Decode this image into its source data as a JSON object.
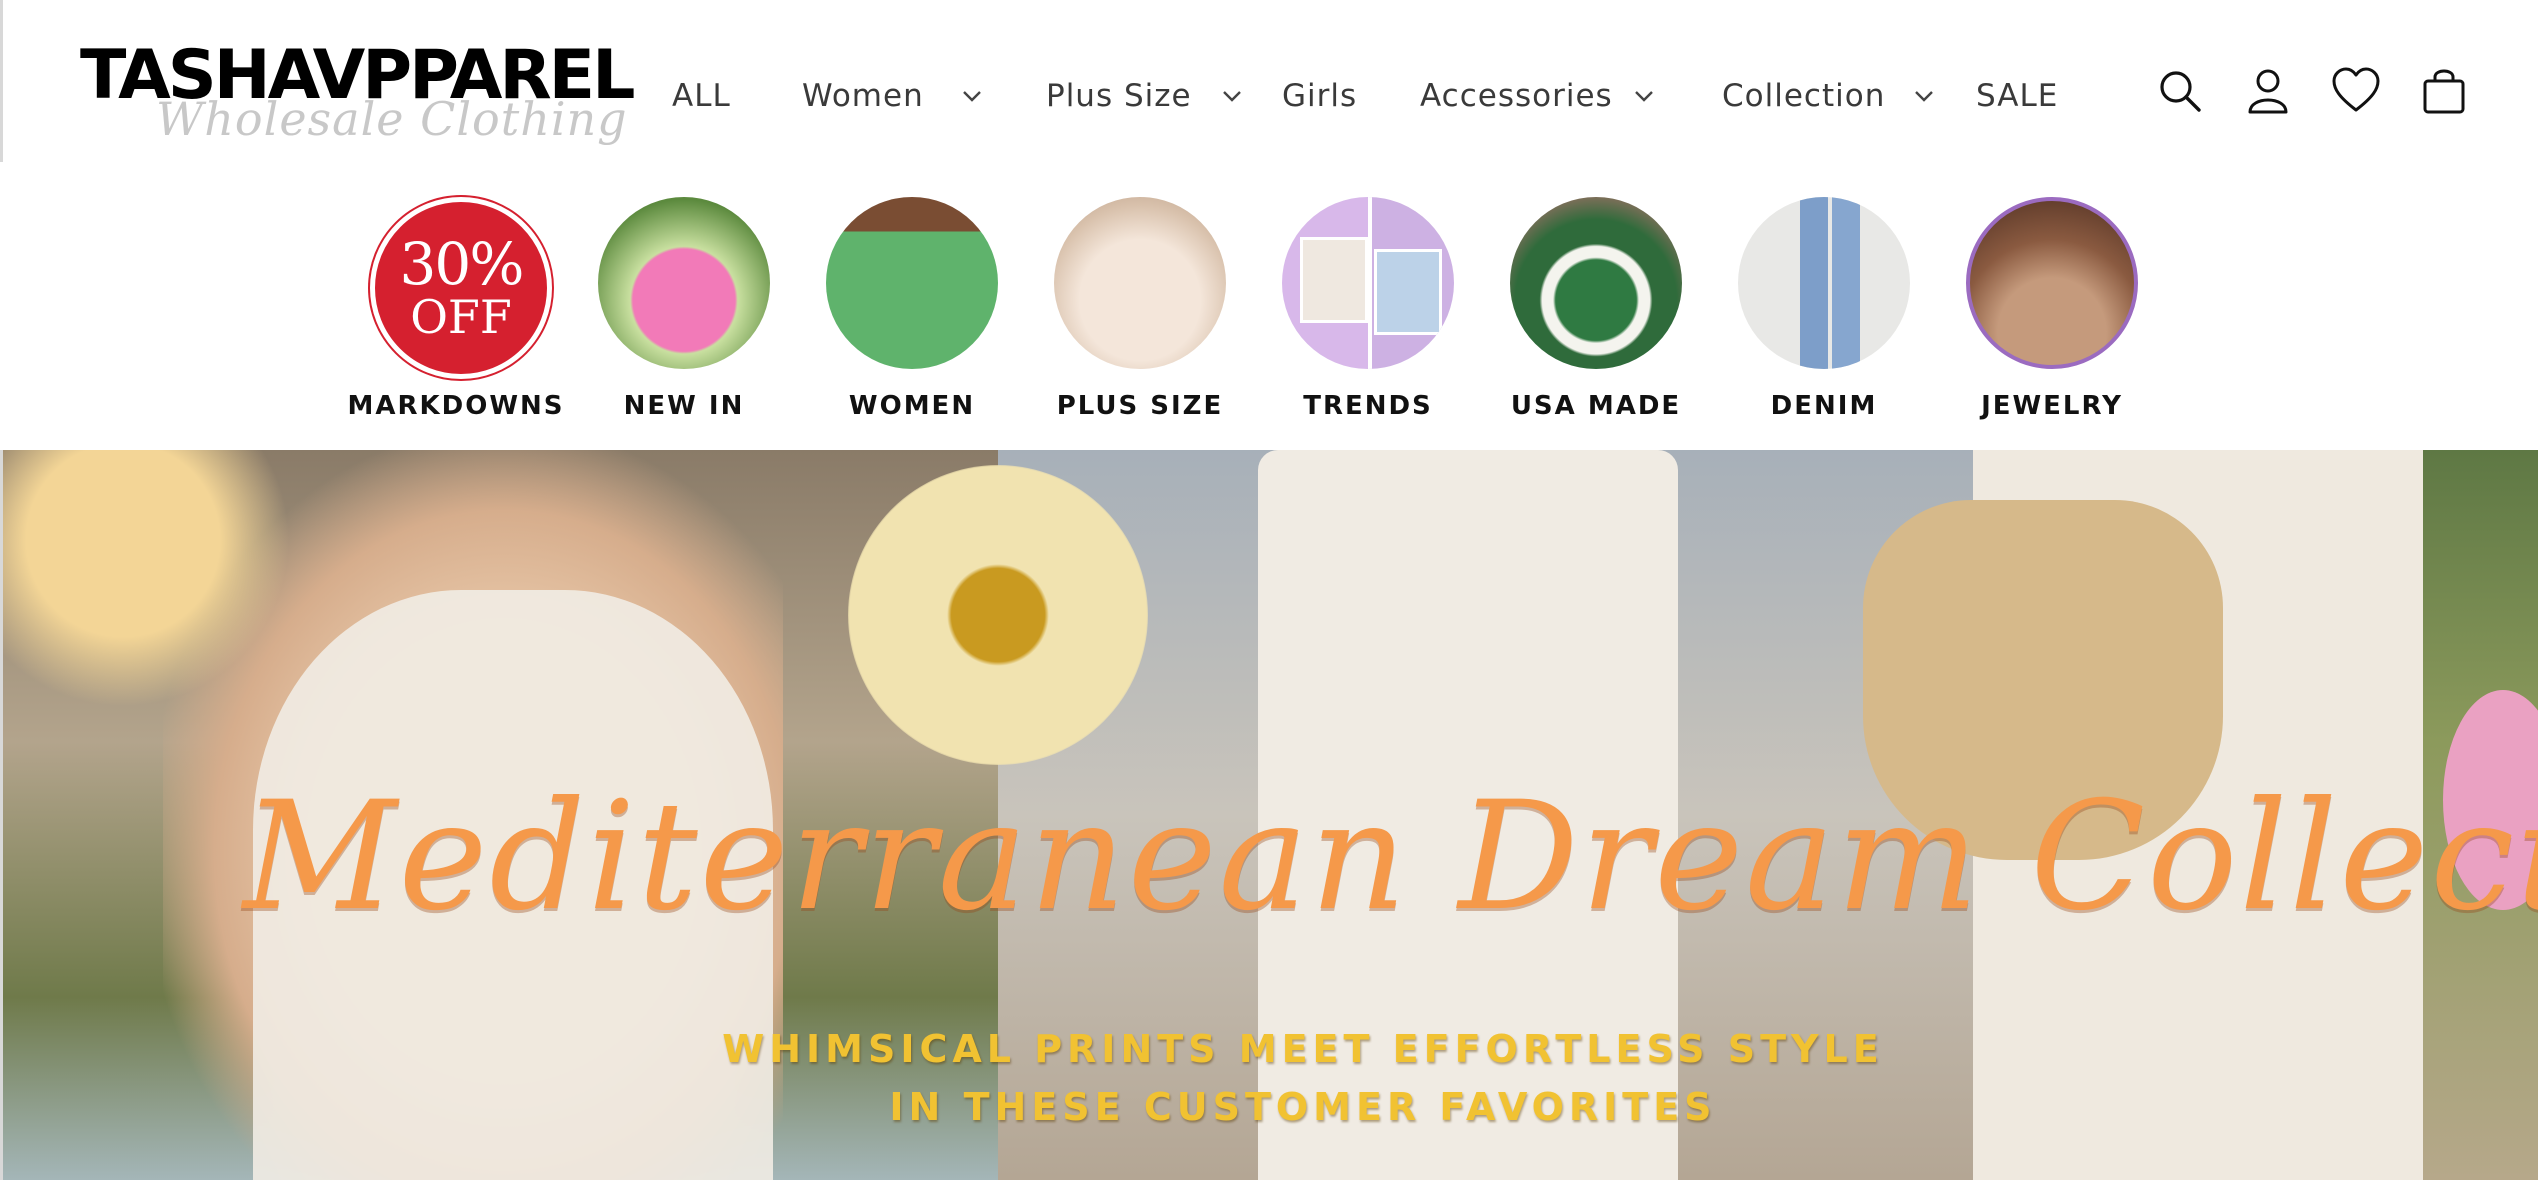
{
  "brand": {
    "name": "TASHAVPPAREL",
    "tagline": "Wholesale Clothing"
  },
  "nav": {
    "items": [
      {
        "label": "ALL",
        "has_dropdown": false
      },
      {
        "label": "Women",
        "has_dropdown": true
      },
      {
        "label": "Plus Size",
        "has_dropdown": true
      },
      {
        "label": "Girls",
        "has_dropdown": false
      },
      {
        "label": "Accessories",
        "has_dropdown": true
      },
      {
        "label": "Collection",
        "has_dropdown": true
      },
      {
        "label": "SALE",
        "has_dropdown": false
      }
    ]
  },
  "header_icons": [
    "search-icon",
    "account-icon",
    "wishlist-heart-icon",
    "cart-icon"
  ],
  "categories": [
    {
      "label": "MARKDOWNS",
      "badge_top": "30%",
      "badge_bottom": "OFF",
      "color": "#d5202f"
    },
    {
      "label": "NEW IN",
      "color": "#ef6fb0"
    },
    {
      "label": "WOMEN",
      "color": "#4ea35a"
    },
    {
      "label": "PLUS SIZE",
      "color": "#e9d9c9"
    },
    {
      "label": "TRENDS",
      "color": "#d7b6ea"
    },
    {
      "label": "USA MADE",
      "color": "#2f6b3b"
    },
    {
      "label": "DENIM",
      "color": "#7d9ec9"
    },
    {
      "label": "JEWELRY",
      "color": "#8a5a40"
    }
  ],
  "hero": {
    "title": "Mediterranean Dream Collection",
    "subtitle_line1": "WHIMSICAL PRINTS MEET EFFORTLESS STYLE",
    "subtitle_line2": "IN THESE CUSTOMER FAVORITES",
    "title_color": "#f5994a",
    "subtitle_color": "#f1c232"
  }
}
